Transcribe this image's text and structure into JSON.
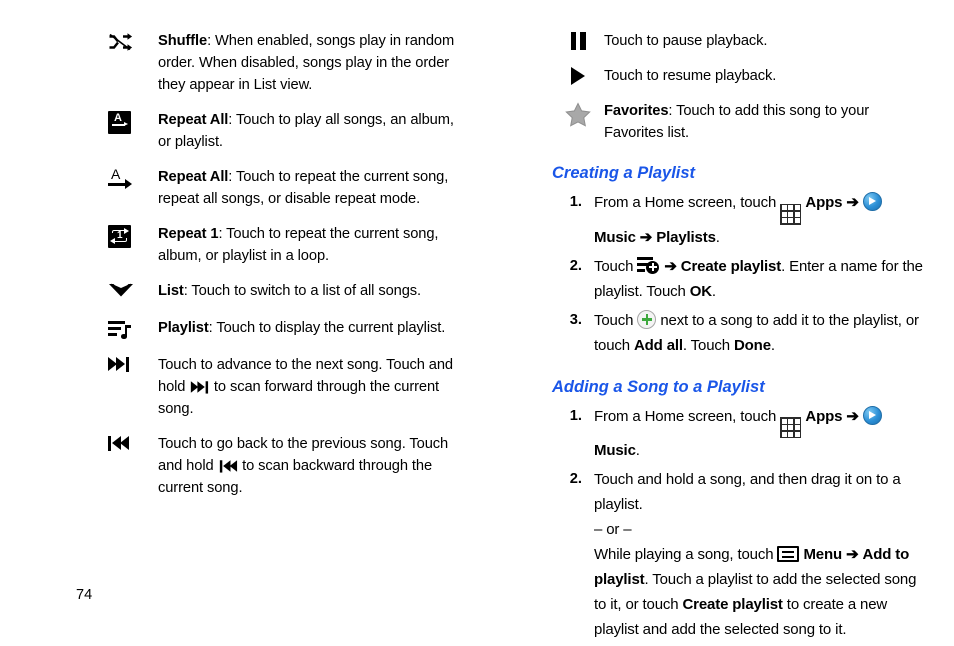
{
  "page": {
    "number": "74"
  },
  "left_column": {
    "rows": [
      {
        "icon": "shuffle-icon",
        "term": "Shuffle",
        "text": ": When enabled, songs play in random order. When disabled, songs play in the order they appear in List view."
      },
      {
        "icon": "repeat-all-box-icon",
        "term": "Repeat All",
        "text": ": Touch to play all songs, an album, or playlist."
      },
      {
        "icon": "repeat-all-icon",
        "term": "Repeat All",
        "text": ": Touch to repeat the current song, repeat all songs, or disable repeat mode."
      },
      {
        "icon": "repeat-one-icon",
        "term": "Repeat 1",
        "text": ": Touch to repeat the current song, album, or playlist in a loop."
      },
      {
        "icon": "chevron-down-icon",
        "term": "List",
        "text": ": Touch to switch to a list of all songs."
      },
      {
        "icon": "playlist-icon",
        "term": "Playlist",
        "text": ": Touch to display the current playlist."
      },
      {
        "icon": "next-track-icon",
        "term": "",
        "text_part1": "Touch to advance to the next song. Touch and hold ",
        "text_part2": " to scan forward through the current song."
      },
      {
        "icon": "previous-track-icon",
        "term": "",
        "text_part1": "Touch to go back to the previous song. Touch and hold ",
        "text_part2": " to scan backward through the current song."
      }
    ]
  },
  "right_column": {
    "rows": [
      {
        "icon": "pause-icon",
        "term": "",
        "text": "Touch to pause playback."
      },
      {
        "icon": "play-icon",
        "term": "",
        "text": "Touch to resume playback."
      },
      {
        "icon": "star-icon",
        "term": "Favorites",
        "text": ": Touch to add this song to your Favorites list."
      }
    ],
    "sections": [
      {
        "heading": "Creating a Playlist",
        "steps": [
          {
            "number": "1.",
            "seg1": "From a Home screen, touch ",
            "apps_label": "Apps",
            "arrow1": "➔",
            "music_label": "Music",
            "arrow2": "➔",
            "bold_tail": "Playlists",
            "tail": "."
          },
          {
            "number": "2.",
            "seg1": "Touch ",
            "arrow1": "➔",
            "bold1": "Create playlist",
            "seg2": ". Enter a name for the playlist. Touch ",
            "bold2": "OK",
            "tail": "."
          },
          {
            "number": "3.",
            "seg1": "Touch ",
            "seg2": " next to a song to add it to the playlist, or touch ",
            "bold1": "Add all",
            "seg3": ". Touch ",
            "bold2": "Done",
            "tail": "."
          }
        ]
      },
      {
        "heading": "Adding a Song to a Playlist",
        "steps": [
          {
            "number": "1.",
            "seg1": "From a Home screen, touch ",
            "apps_label": "Apps",
            "arrow1": "➔",
            "music_label": "Music",
            "tail": "."
          },
          {
            "number": "2.",
            "seg1": "Touch and hold a song, and then drag it on to a playlist.",
            "or": "– or –",
            "seg2": "While playing a song, touch ",
            "menu_label": "Menu",
            "arrow1": "➔",
            "bold1": "Add to playlist",
            "seg3": ". Touch a playlist to add the selected song to it, or touch ",
            "bold2": "Create playlist",
            "seg4": " to create a new playlist and add the selected song to it."
          }
        ]
      }
    ]
  },
  "colors": {
    "heading_blue": "#1a56e8",
    "favorites_star_gray": "#a8a8a8",
    "add_plus_green": "#3ea93e"
  }
}
